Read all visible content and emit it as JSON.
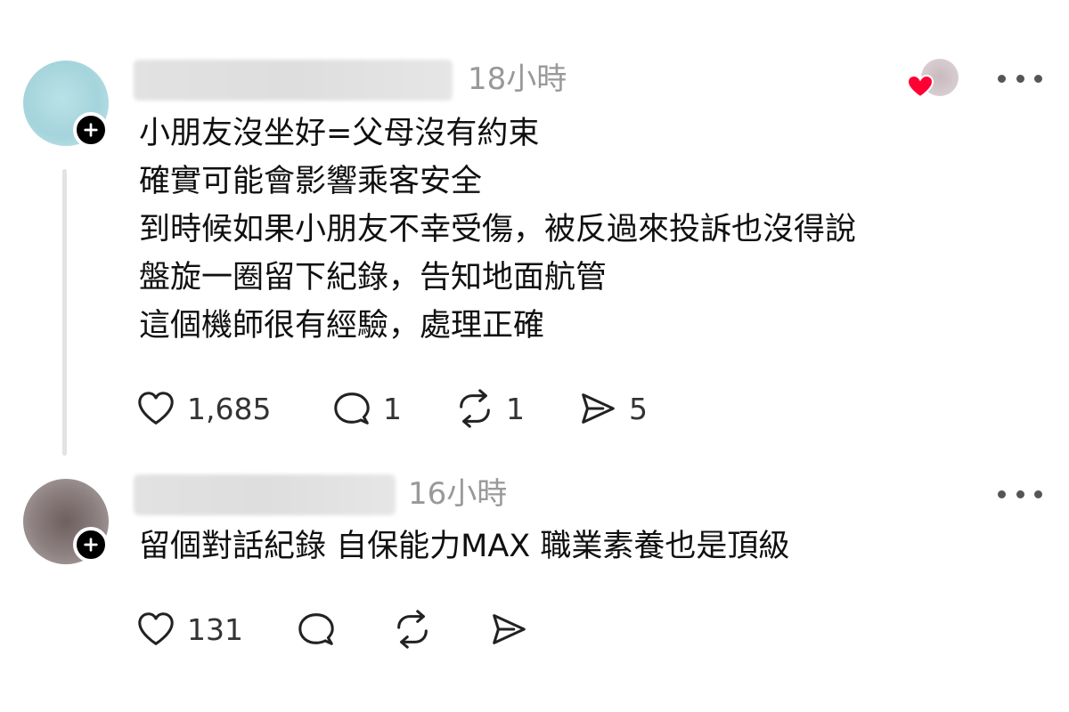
{
  "comments": [
    {
      "timestamp": "18小時",
      "lines": [
        "小朋友沒坐好=父母沒有約束",
        "確實可能會影響乘客安全",
        "到時候如果小朋友不幸受傷，被反過來投訴也沒得說",
        "盤旋一圈留下紀錄，告知地面航管",
        "這個機師很有經驗，處理正確"
      ],
      "actions": {
        "likes": "1,685",
        "replies": "1",
        "reposts": "1",
        "shares": "5"
      },
      "liked_by_author": true
    },
    {
      "timestamp": "16小時",
      "lines": [
        "留個對話紀錄 自保能力MAX 職業素養也是頂級"
      ],
      "actions": {
        "likes": "131",
        "replies": "",
        "reposts": "",
        "shares": ""
      },
      "liked_by_author": false
    }
  ],
  "icons": {
    "like": "heart-outline-icon",
    "reply": "speech-bubble-icon",
    "repost": "repost-arrows-icon",
    "share": "send-icon",
    "follow": "plus-icon",
    "more": "more-dots-icon",
    "liked_badge": "red-heart-icon"
  },
  "colors": {
    "text": "#101010",
    "muted": "#999999",
    "heart_badge": "#ff0034"
  }
}
